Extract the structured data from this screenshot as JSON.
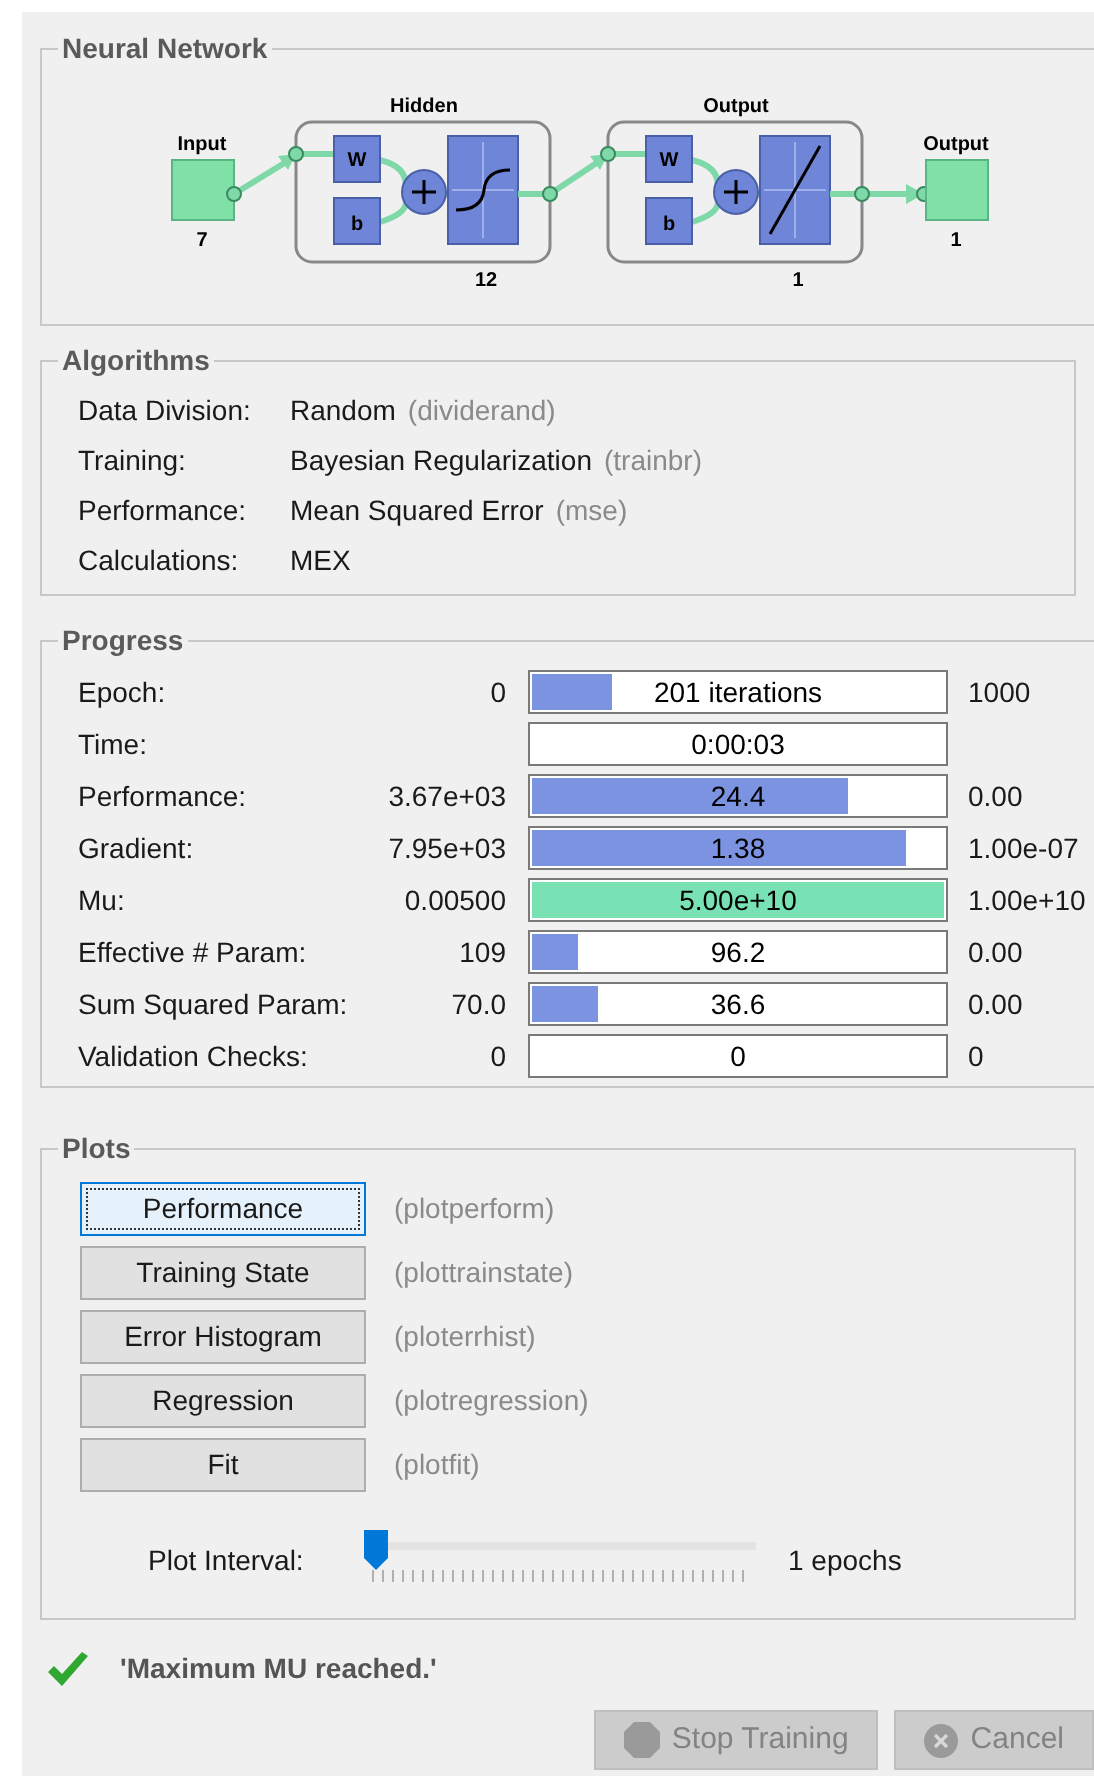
{
  "network": {
    "title": "Neural Network",
    "input": {
      "label": "Input",
      "size": "7"
    },
    "layers": [
      {
        "label": "Hidden",
        "size": "12",
        "w": "W",
        "b": "b",
        "kind": "sigmoid"
      },
      {
        "label": "Output",
        "size": "1",
        "w": "W",
        "b": "b",
        "kind": "linear"
      }
    ],
    "output": {
      "label": "Output",
      "size": "1"
    }
  },
  "algorithms": {
    "title": "Algorithms",
    "rows": [
      {
        "label": "Data Division:",
        "value": "Random",
        "fn": "(dividerand)"
      },
      {
        "label": "Training:",
        "value": "Bayesian Regularization",
        "fn": "(trainbr)"
      },
      {
        "label": "Performance:",
        "value": "Mean Squared Error",
        "fn": "(mse)"
      },
      {
        "label": "Calculations:",
        "value": "MEX"
      }
    ]
  },
  "progress": {
    "title": "Progress",
    "rows": [
      {
        "label": "Epoch:",
        "start": "0",
        "bar": "201 iterations",
        "end": "1000",
        "level": 0.2,
        "color": "#7b93e0"
      },
      {
        "label": "Time:",
        "bar": "0:00:03"
      },
      {
        "label": "Performance:",
        "start": "3.67e+03",
        "bar": "24.4",
        "end": "0.00",
        "level": 0.77,
        "color": "#7b93e0"
      },
      {
        "label": "Gradient:",
        "start": "7.95e+03",
        "bar": "1.38",
        "end": "1.00e-07",
        "level": 0.91,
        "color": "#7b93e0"
      },
      {
        "label": "Mu:",
        "start": "0.00500",
        "bar": "5.00e+10",
        "end": "1.00e+10",
        "level": 1,
        "color": "#78e2b4"
      },
      {
        "label": "Effective # Param:",
        "start": "109",
        "bar": "96.2",
        "end": "0.00",
        "level": 0.12,
        "color": "#7b93e0"
      },
      {
        "label": "Sum Squared Param:",
        "start": "70.0",
        "bar": "36.6",
        "end": "0.00",
        "level": 0.17,
        "color": "#7b93e0"
      },
      {
        "label": "Validation Checks:",
        "start": "0",
        "bar": "0",
        "end": "0"
      }
    ]
  },
  "plots": {
    "title": "Plots",
    "buttons": [
      {
        "label": "Performance",
        "fn": "(plotperform)",
        "selected": true
      },
      {
        "label": "Training State",
        "fn": "(plottrainstate)",
        "selected": false
      },
      {
        "label": "Error Histogram",
        "fn": "(ploterrhist)",
        "selected": false
      },
      {
        "label": "Regression",
        "fn": "(plotregression)",
        "selected": false
      },
      {
        "label": "Fit",
        "fn": "(plotfit)",
        "selected": false
      }
    ],
    "interval": {
      "label": "Plot Interval:",
      "level": 0,
      "reading": "1 epochs"
    }
  },
  "status": "'Maximum MU reached.'",
  "buttons": [
    {
      "label": "Stop Training",
      "kind": "stop",
      "disabled": true
    },
    {
      "label": "Cancel",
      "kind": "cancel",
      "disabled": true
    }
  ]
}
